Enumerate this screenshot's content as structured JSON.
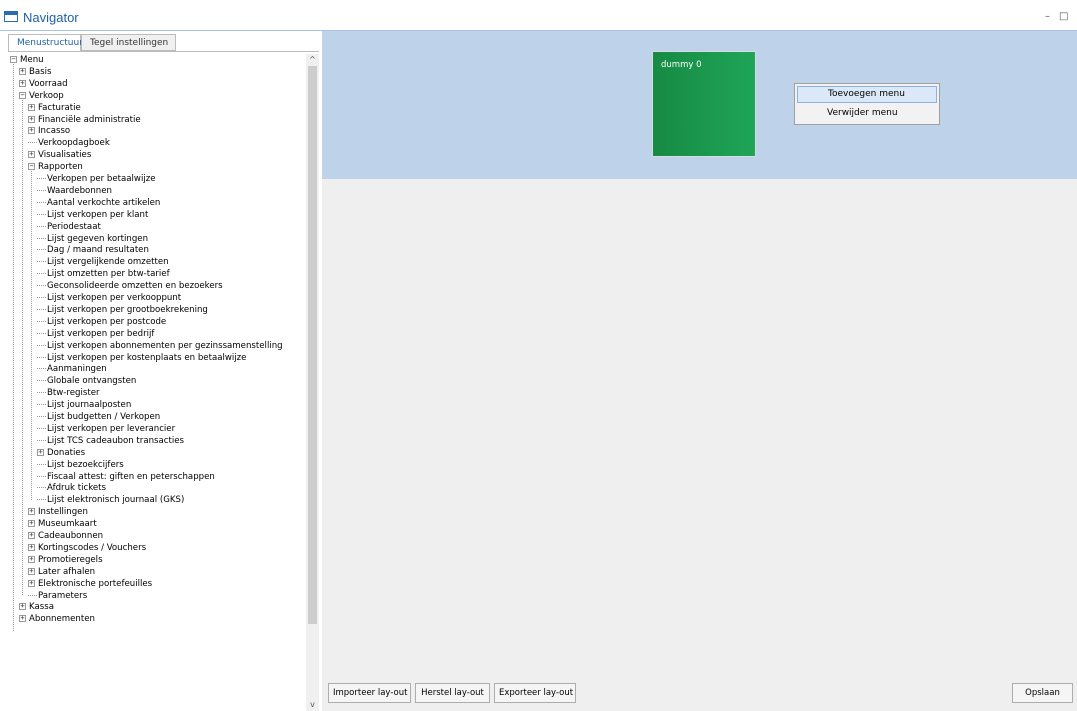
{
  "window": {
    "title": "Navigator",
    "minimize": "–",
    "maximize": "□"
  },
  "tabs": [
    {
      "label": "Menustructuur",
      "active": true
    },
    {
      "label": "Tegel instellingen",
      "active": false
    }
  ],
  "tree": [
    {
      "label": "Menu",
      "level": 0,
      "state": "expanded"
    },
    {
      "label": "Basis",
      "level": 1,
      "state": "collapsed"
    },
    {
      "label": "Voorraad",
      "level": 1,
      "state": "collapsed"
    },
    {
      "label": "Verkoop",
      "level": 1,
      "state": "expanded"
    },
    {
      "label": "Facturatie",
      "level": 2,
      "state": "collapsed"
    },
    {
      "label": "Financiële administratie",
      "level": 2,
      "state": "collapsed"
    },
    {
      "label": "Incasso",
      "level": 2,
      "state": "collapsed"
    },
    {
      "label": "Verkoopdagboek",
      "level": 2,
      "state": "leaf"
    },
    {
      "label": "Visualisaties",
      "level": 2,
      "state": "collapsed"
    },
    {
      "label": "Rapporten",
      "level": 2,
      "state": "expanded"
    },
    {
      "label": "Verkopen per betaalwijze",
      "level": 3,
      "state": "leaf"
    },
    {
      "label": "Waardebonnen",
      "level": 3,
      "state": "leaf"
    },
    {
      "label": "Aantal verkochte artikelen",
      "level": 3,
      "state": "leaf"
    },
    {
      "label": "Lijst verkopen per klant",
      "level": 3,
      "state": "leaf"
    },
    {
      "label": "Periodestaat",
      "level": 3,
      "state": "leaf"
    },
    {
      "label": "Lijst gegeven kortingen",
      "level": 3,
      "state": "leaf"
    },
    {
      "label": "Dag / maand resultaten",
      "level": 3,
      "state": "leaf"
    },
    {
      "label": "Lijst vergelijkende omzetten",
      "level": 3,
      "state": "leaf"
    },
    {
      "label": "Lijst omzetten per btw-tarief",
      "level": 3,
      "state": "leaf"
    },
    {
      "label": "Geconsolideerde omzetten en bezoekers",
      "level": 3,
      "state": "leaf"
    },
    {
      "label": "Lijst verkopen per verkooppunt",
      "level": 3,
      "state": "leaf"
    },
    {
      "label": "Lijst verkopen per grootboekrekening",
      "level": 3,
      "state": "leaf"
    },
    {
      "label": "Lijst verkopen per postcode",
      "level": 3,
      "state": "leaf"
    },
    {
      "label": "Lijst verkopen per bedrijf",
      "level": 3,
      "state": "leaf"
    },
    {
      "label": "Lijst verkopen abonnementen per gezinssamenstelling",
      "level": 3,
      "state": "leaf"
    },
    {
      "label": "Lijst verkopen per kostenplaats en betaalwijze",
      "level": 3,
      "state": "leaf"
    },
    {
      "label": "Aanmaningen",
      "level": 3,
      "state": "leaf"
    },
    {
      "label": "Globale ontvangsten",
      "level": 3,
      "state": "leaf"
    },
    {
      "label": "Btw-register",
      "level": 3,
      "state": "leaf"
    },
    {
      "label": "Lijst journaalposten",
      "level": 3,
      "state": "leaf"
    },
    {
      "label": "Lijst budgetten / Verkopen",
      "level": 3,
      "state": "leaf"
    },
    {
      "label": "Lijst verkopen per leverancier",
      "level": 3,
      "state": "leaf"
    },
    {
      "label": "Lijst TCS cadeaubon transacties",
      "level": 3,
      "state": "leaf"
    },
    {
      "label": "Donaties",
      "level": 3,
      "state": "collapsed"
    },
    {
      "label": "Lijst bezoekcijfers",
      "level": 3,
      "state": "leaf"
    },
    {
      "label": "Fiscaal attest: giften en peterschappen",
      "level": 3,
      "state": "leaf"
    },
    {
      "label": "Afdruk tickets",
      "level": 3,
      "state": "leaf"
    },
    {
      "label": "Lijst elektronisch journaal (GKS)",
      "level": 3,
      "state": "leaf"
    },
    {
      "label": "Instellingen",
      "level": 2,
      "state": "collapsed"
    },
    {
      "label": "Museumkaart",
      "level": 2,
      "state": "collapsed"
    },
    {
      "label": "Cadeaubonnen",
      "level": 2,
      "state": "collapsed"
    },
    {
      "label": "Kortingscodes / Vouchers",
      "level": 2,
      "state": "collapsed"
    },
    {
      "label": "Promotieregels",
      "level": 2,
      "state": "collapsed"
    },
    {
      "label": "Later afhalen",
      "level": 2,
      "state": "collapsed"
    },
    {
      "label": "Elektronische portefeuilles",
      "level": 2,
      "state": "collapsed"
    },
    {
      "label": "Parameters",
      "level": 2,
      "state": "leaf"
    },
    {
      "label": "Kassa",
      "level": 1,
      "state": "collapsed"
    },
    {
      "label": "Abonnementen",
      "level": 1,
      "state": "collapsed"
    }
  ],
  "tile": {
    "label": "dummy 0",
    "color": "#1a9a50"
  },
  "context_menu": {
    "items": [
      {
        "label": "Toevoegen menu",
        "highlighted": true
      },
      {
        "label": "Verwijder menu",
        "highlighted": false
      }
    ]
  },
  "buttons": {
    "import": "Importeer lay-out",
    "restore": "Herstel lay-out",
    "export": "Exporteer lay-out",
    "save": "Opslaan"
  },
  "scroll": {
    "up_arrow": "^",
    "down_arrow": "v"
  },
  "colors": {
    "accent": "#1f5fa8",
    "panel_blue": "#bed3ea",
    "background": "#efefef"
  }
}
